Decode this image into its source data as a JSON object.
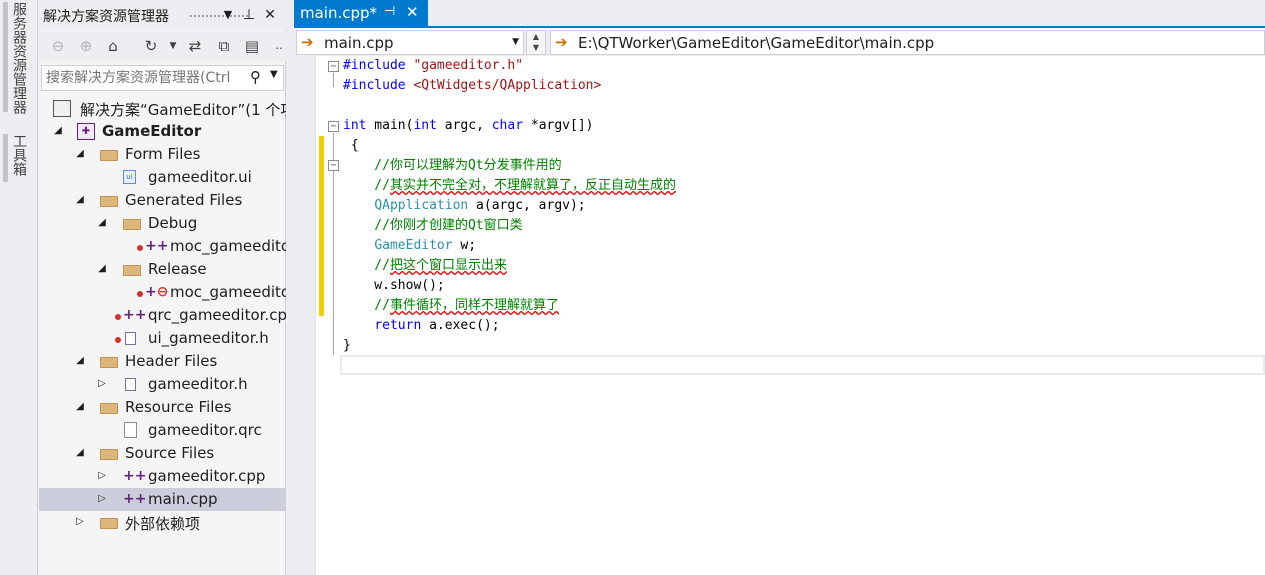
{
  "side_strip": {
    "tabs": [
      "服务器资源管理器",
      "工具箱"
    ]
  },
  "explorer": {
    "title": "解决方案资源管理器",
    "title_buttons": {
      "dropdown": "▼",
      "pin": "⊥",
      "close": "✕"
    },
    "search_placeholder": "搜索解决方案资源管理器(Ctrl",
    "tree": [
      {
        "label": "解决方案“GameEditor”(1 个项",
        "icon": "solution-icon",
        "arrow": ""
      },
      {
        "label": "GameEditor",
        "icon": "project-icon",
        "arrow": "◢"
      },
      {
        "label": "Form Files",
        "icon": "folder-icon",
        "arrow": "◢"
      },
      {
        "label": "gameeditor.ui",
        "icon": "ui-file-icon",
        "arrow": ""
      },
      {
        "label": "Generated Files",
        "icon": "folder-icon",
        "arrow": "◢"
      },
      {
        "label": "Debug",
        "icon": "folder-icon",
        "arrow": "◢"
      },
      {
        "label": "moc_gameedito",
        "icon": "cpp-file-icon",
        "arrow": ""
      },
      {
        "label": "Release",
        "icon": "folder-icon",
        "arrow": "◢"
      },
      {
        "label": "moc_gameedito",
        "icon": "cpp-file-excluded-icon",
        "arrow": ""
      },
      {
        "label": "qrc_gameeditor.cp",
        "icon": "cpp-file-icon",
        "arrow": ""
      },
      {
        "label": "ui_gameeditor.h",
        "icon": "header-file-icon",
        "arrow": ""
      },
      {
        "label": "Header Files",
        "icon": "folder-icon",
        "arrow": "◢"
      },
      {
        "label": "gameeditor.h",
        "icon": "header-file-icon",
        "arrow": "▷"
      },
      {
        "label": "Resource Files",
        "icon": "folder-icon",
        "arrow": "◢"
      },
      {
        "label": "gameeditor.qrc",
        "icon": "qrc-file-icon",
        "arrow": ""
      },
      {
        "label": "Source Files",
        "icon": "folder-icon",
        "arrow": "◢"
      },
      {
        "label": "gameeditor.cpp",
        "icon": "cpp-file-icon",
        "arrow": "▷"
      },
      {
        "label": "main.cpp",
        "icon": "cpp-file-icon",
        "arrow": "▷"
      },
      {
        "label": "外部依赖项",
        "icon": "external-deps-icon",
        "arrow": "▷"
      }
    ]
  },
  "editor": {
    "tab": {
      "label": "main.cpp*",
      "pin": "⊣",
      "close": "✕"
    },
    "nav": {
      "file": "main.cpp",
      "path": "E:\\QTWorker\\GameEditor\\GameEditor\\main.cpp"
    },
    "code": {
      "l1a": "#include ",
      "l1b": "\"gameeditor.h\"",
      "l2a": "#include ",
      "l2b": "<QtWidgets/QApplication>",
      "l4a": "int",
      "l4b": " main(",
      "l4c": "int",
      "l4d": " argc, ",
      "l4e": "char",
      "l4f": " *argv[])",
      "l5": " {",
      "l6": "    //你可以理解为Qt分发事件用的",
      "l7a": "    //",
      "l7b": "其实并不完全对，不理解就算了，反正自动生成的",
      "l8a": "    ",
      "l8b": "QApplication",
      "l8c": " a(argc, argv);",
      "l9": "    //你刚才创建的Qt窗口类",
      "l10a": "    ",
      "l10b": "GameEditor",
      "l10c": " w;",
      "l11a": "    //",
      "l11b": "把这个窗口显示出来",
      "l12": "    w.show();",
      "l13a": "    //",
      "l13b": "事件循环，同样不理解就算了",
      "l14a": "    ",
      "l14b": "return",
      "l14c": " a.exec();",
      "l15": "}"
    }
  },
  "colors": {
    "accent": "#007acc",
    "keyword": "#0000ff",
    "string": "#a31515",
    "type": "#2b91af",
    "comment": "#008000"
  }
}
